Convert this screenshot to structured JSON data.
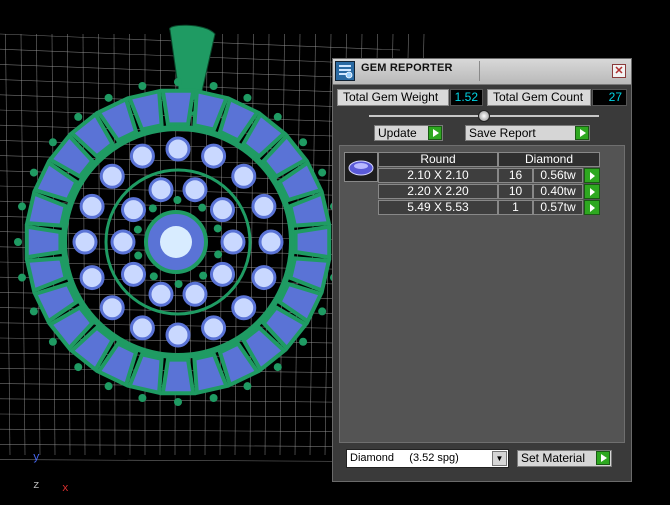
{
  "viewport": {
    "axes": {
      "y": "y",
      "z": "z",
      "x": "x"
    },
    "colors": {
      "grid": "#9a9a9a",
      "metal": "#1f9b63",
      "gem": "#5a73d6",
      "gem_light": "#c9d8ff",
      "background": "#000000"
    }
  },
  "panel": {
    "title": "GEM REPORTER",
    "close_glyph": "✕",
    "stats": {
      "weight_label": "Total Gem Weight",
      "weight_value": "1.52",
      "count_label": "Total Gem Count",
      "count_value": "27"
    },
    "buttons": {
      "update": "Update",
      "save_report": "Save Report",
      "set_material": "Set Material"
    },
    "table": {
      "headers": {
        "shape": "Round",
        "material": "Diamond"
      },
      "rows": [
        {
          "size": "2.10 X 2.10",
          "count": "16",
          "weight": "0.56tw"
        },
        {
          "size": "2.20 X 2.20",
          "count": "10",
          "weight": "0.40tw"
        },
        {
          "size": "5.49 X 5.53",
          "count": "1",
          "weight": "0.57tw"
        }
      ]
    },
    "material_select": {
      "value": "Diamond     (3.52 spg)",
      "arrow": "▼"
    }
  }
}
